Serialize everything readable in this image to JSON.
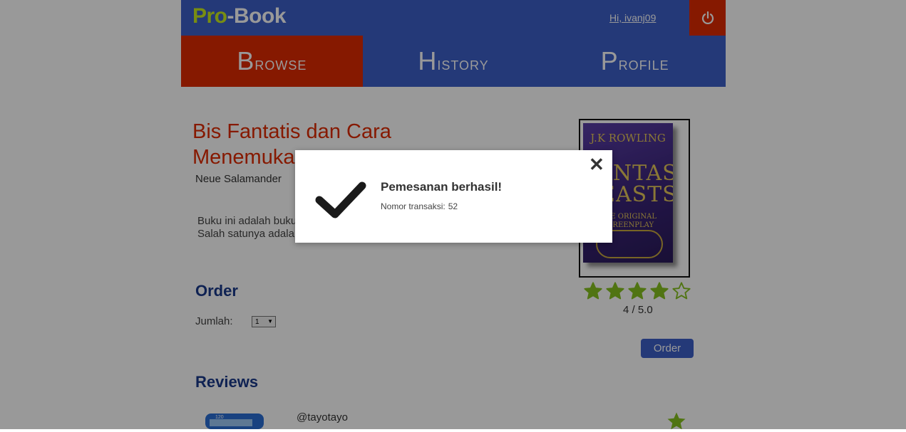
{
  "header": {
    "logo_pro": "Pro",
    "logo_book": "-Book",
    "greeting": "Hi, ivanj09",
    "logout_icon": "power-icon",
    "colors": {
      "primary": "#3d5fc9",
      "accent": "#e02a00",
      "logo_green": "#c8ec1e"
    }
  },
  "tabs": [
    {
      "label": "Browse",
      "active": true
    },
    {
      "label": "History",
      "active": false
    },
    {
      "label": "Profile",
      "active": false
    }
  ],
  "book": {
    "title": "Bis Fantatis dan Cara Menemukannya",
    "author": "Neue Salamander",
    "description": "Buku ini adalah buku tentang makhluk-makhluk fantastis dari masa lampau. Salah satunya adalah hewan-hewan ajaib",
    "cover": {
      "author": "J.K ROWLING",
      "title": "FANTASTIC BEASTS",
      "subtitle": "THE ORIGINAL SCREENPLAY"
    },
    "rating_stars": 4,
    "rating_max_stars": 5,
    "rating_text": "4 / 5.0"
  },
  "order": {
    "heading": "Order",
    "quantity_label": "Jumlah:",
    "quantity_value": "1",
    "button_label": "Order"
  },
  "reviews": {
    "heading": "Reviews",
    "items": [
      {
        "username": "@tayotayo",
        "stars": 1
      }
    ]
  },
  "modal": {
    "title": "Pemesanan berhasil!",
    "message_label": "Nomor transaksi:",
    "transaction_number": "52",
    "close_icon": "close-icon",
    "status_icon": "checkmark-icon"
  }
}
